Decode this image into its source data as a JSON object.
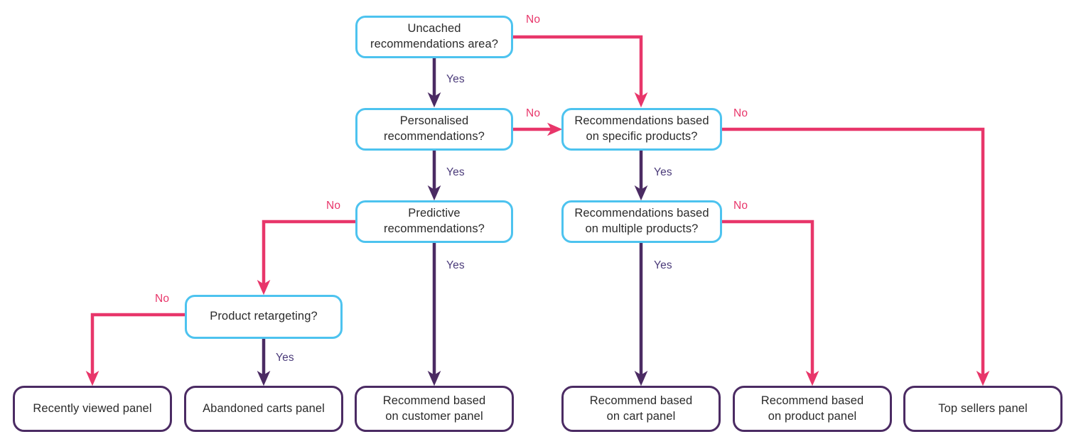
{
  "diagram": {
    "title": "Recommendations panel decision flowchart",
    "colors": {
      "decision_border": "#4dc3ef",
      "terminal_border": "#4b2b63",
      "yes_edge": "#4b2b63",
      "no_edge": "#e8366a",
      "yes_label": "#4b3b7a",
      "no_label": "#e8366a",
      "node_fill": "#ffffff",
      "text": "#2b2b2b",
      "background": "#ffffff"
    },
    "nodes": [
      {
        "id": "uncached",
        "kind": "decision",
        "text": "Uncached\nrecommendations area?"
      },
      {
        "id": "personalised",
        "kind": "decision",
        "text": "Personalised\nrecommendations?"
      },
      {
        "id": "specific",
        "kind": "decision",
        "text": "Recommendations based\non specific products?"
      },
      {
        "id": "predictive",
        "kind": "decision",
        "text": "Predictive\nrecommendations?"
      },
      {
        "id": "multiple",
        "kind": "decision",
        "text": "Recommendations based\non multiple products?"
      },
      {
        "id": "retargeting",
        "kind": "decision",
        "text": "Product retargeting?"
      },
      {
        "id": "recently-viewed",
        "kind": "terminal",
        "text": "Recently viewed panel"
      },
      {
        "id": "abandoned-carts",
        "kind": "terminal",
        "text": "Abandoned carts panel"
      },
      {
        "id": "customer-panel",
        "kind": "terminal",
        "text": "Recommend based\non customer panel"
      },
      {
        "id": "cart-panel",
        "kind": "terminal",
        "text": "Recommend based\non cart panel"
      },
      {
        "id": "product-panel",
        "kind": "terminal",
        "text": "Recommend based\non product panel"
      },
      {
        "id": "top-sellers",
        "kind": "terminal",
        "text": "Top sellers panel"
      }
    ],
    "edge_labels": [
      {
        "id": "no-uncached",
        "text": "No"
      },
      {
        "id": "yes-uncached",
        "text": "Yes"
      },
      {
        "id": "no-personalised",
        "text": "No"
      },
      {
        "id": "yes-personalised",
        "text": "Yes"
      },
      {
        "id": "no-specific",
        "text": "No"
      },
      {
        "id": "yes-specific",
        "text": "Yes"
      },
      {
        "id": "no-predictive",
        "text": "No"
      },
      {
        "id": "yes-predictive",
        "text": "Yes"
      },
      {
        "id": "no-multiple",
        "text": "No"
      },
      {
        "id": "yes-multiple",
        "text": "Yes"
      },
      {
        "id": "no-retargeting",
        "text": "No"
      },
      {
        "id": "yes-retargeting",
        "text": "Yes"
      }
    ]
  }
}
